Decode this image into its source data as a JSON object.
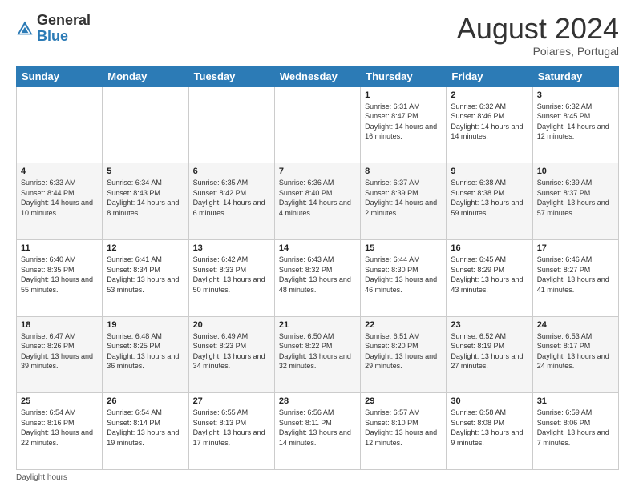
{
  "logo": {
    "text_general": "General",
    "text_blue": "Blue"
  },
  "title": {
    "month_year": "August 2024",
    "location": "Poiares, Portugal"
  },
  "days_of_week": [
    "Sunday",
    "Monday",
    "Tuesday",
    "Wednesday",
    "Thursday",
    "Friday",
    "Saturday"
  ],
  "footer": {
    "daylight_label": "Daylight hours"
  },
  "weeks": [
    {
      "days": [
        {
          "num": "",
          "sunrise": "",
          "sunset": "",
          "daylight": ""
        },
        {
          "num": "",
          "sunrise": "",
          "sunset": "",
          "daylight": ""
        },
        {
          "num": "",
          "sunrise": "",
          "sunset": "",
          "daylight": ""
        },
        {
          "num": "",
          "sunrise": "",
          "sunset": "",
          "daylight": ""
        },
        {
          "num": "1",
          "sunrise": "6:31 AM",
          "sunset": "8:47 PM",
          "daylight": "14 hours and 16 minutes."
        },
        {
          "num": "2",
          "sunrise": "6:32 AM",
          "sunset": "8:46 PM",
          "daylight": "14 hours and 14 minutes."
        },
        {
          "num": "3",
          "sunrise": "6:32 AM",
          "sunset": "8:45 PM",
          "daylight": "14 hours and 12 minutes."
        }
      ]
    },
    {
      "days": [
        {
          "num": "4",
          "sunrise": "6:33 AM",
          "sunset": "8:44 PM",
          "daylight": "14 hours and 10 minutes."
        },
        {
          "num": "5",
          "sunrise": "6:34 AM",
          "sunset": "8:43 PM",
          "daylight": "14 hours and 8 minutes."
        },
        {
          "num": "6",
          "sunrise": "6:35 AM",
          "sunset": "8:42 PM",
          "daylight": "14 hours and 6 minutes."
        },
        {
          "num": "7",
          "sunrise": "6:36 AM",
          "sunset": "8:40 PM",
          "daylight": "14 hours and 4 minutes."
        },
        {
          "num": "8",
          "sunrise": "6:37 AM",
          "sunset": "8:39 PM",
          "daylight": "14 hours and 2 minutes."
        },
        {
          "num": "9",
          "sunrise": "6:38 AM",
          "sunset": "8:38 PM",
          "daylight": "13 hours and 59 minutes."
        },
        {
          "num": "10",
          "sunrise": "6:39 AM",
          "sunset": "8:37 PM",
          "daylight": "13 hours and 57 minutes."
        }
      ]
    },
    {
      "days": [
        {
          "num": "11",
          "sunrise": "6:40 AM",
          "sunset": "8:35 PM",
          "daylight": "13 hours and 55 minutes."
        },
        {
          "num": "12",
          "sunrise": "6:41 AM",
          "sunset": "8:34 PM",
          "daylight": "13 hours and 53 minutes."
        },
        {
          "num": "13",
          "sunrise": "6:42 AM",
          "sunset": "8:33 PM",
          "daylight": "13 hours and 50 minutes."
        },
        {
          "num": "14",
          "sunrise": "6:43 AM",
          "sunset": "8:32 PM",
          "daylight": "13 hours and 48 minutes."
        },
        {
          "num": "15",
          "sunrise": "6:44 AM",
          "sunset": "8:30 PM",
          "daylight": "13 hours and 46 minutes."
        },
        {
          "num": "16",
          "sunrise": "6:45 AM",
          "sunset": "8:29 PM",
          "daylight": "13 hours and 43 minutes."
        },
        {
          "num": "17",
          "sunrise": "6:46 AM",
          "sunset": "8:27 PM",
          "daylight": "13 hours and 41 minutes."
        }
      ]
    },
    {
      "days": [
        {
          "num": "18",
          "sunrise": "6:47 AM",
          "sunset": "8:26 PM",
          "daylight": "13 hours and 39 minutes."
        },
        {
          "num": "19",
          "sunrise": "6:48 AM",
          "sunset": "8:25 PM",
          "daylight": "13 hours and 36 minutes."
        },
        {
          "num": "20",
          "sunrise": "6:49 AM",
          "sunset": "8:23 PM",
          "daylight": "13 hours and 34 minutes."
        },
        {
          "num": "21",
          "sunrise": "6:50 AM",
          "sunset": "8:22 PM",
          "daylight": "13 hours and 32 minutes."
        },
        {
          "num": "22",
          "sunrise": "6:51 AM",
          "sunset": "8:20 PM",
          "daylight": "13 hours and 29 minutes."
        },
        {
          "num": "23",
          "sunrise": "6:52 AM",
          "sunset": "8:19 PM",
          "daylight": "13 hours and 27 minutes."
        },
        {
          "num": "24",
          "sunrise": "6:53 AM",
          "sunset": "8:17 PM",
          "daylight": "13 hours and 24 minutes."
        }
      ]
    },
    {
      "days": [
        {
          "num": "25",
          "sunrise": "6:54 AM",
          "sunset": "8:16 PM",
          "daylight": "13 hours and 22 minutes."
        },
        {
          "num": "26",
          "sunrise": "6:54 AM",
          "sunset": "8:14 PM",
          "daylight": "13 hours and 19 minutes."
        },
        {
          "num": "27",
          "sunrise": "6:55 AM",
          "sunset": "8:13 PM",
          "daylight": "13 hours and 17 minutes."
        },
        {
          "num": "28",
          "sunrise": "6:56 AM",
          "sunset": "8:11 PM",
          "daylight": "13 hours and 14 minutes."
        },
        {
          "num": "29",
          "sunrise": "6:57 AM",
          "sunset": "8:10 PM",
          "daylight": "13 hours and 12 minutes."
        },
        {
          "num": "30",
          "sunrise": "6:58 AM",
          "sunset": "8:08 PM",
          "daylight": "13 hours and 9 minutes."
        },
        {
          "num": "31",
          "sunrise": "6:59 AM",
          "sunset": "8:06 PM",
          "daylight": "13 hours and 7 minutes."
        }
      ]
    }
  ]
}
